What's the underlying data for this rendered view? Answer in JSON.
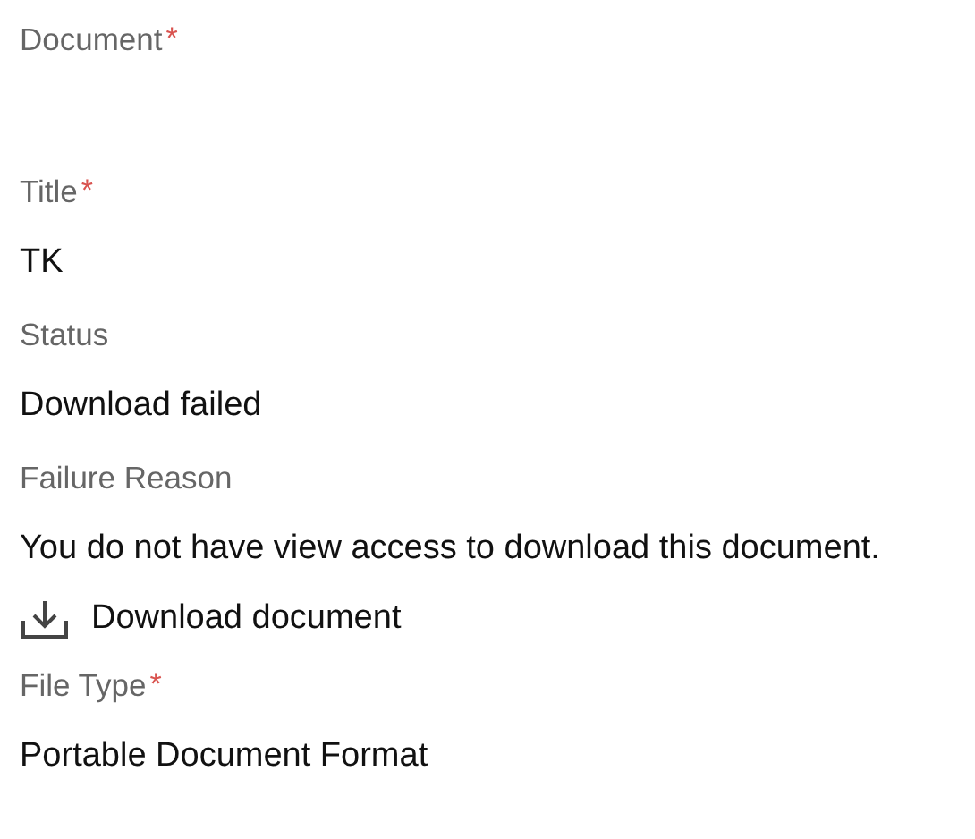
{
  "fields": [
    {
      "kind": "field",
      "label": "Document",
      "required_mark": "*"
    },
    {
      "kind": "field",
      "label": "Title",
      "required_mark": "*",
      "value": "TK"
    },
    {
      "kind": "field",
      "label": "Status",
      "value": "Download failed"
    },
    {
      "kind": "field",
      "label": "Failure Reason",
      "value": "You do not have view access to download this document."
    },
    {
      "kind": "link",
      "label": "Download document"
    },
    {
      "kind": "field",
      "label": "File Type",
      "required_mark": "*",
      "value": "Portable Document Format"
    }
  ]
}
